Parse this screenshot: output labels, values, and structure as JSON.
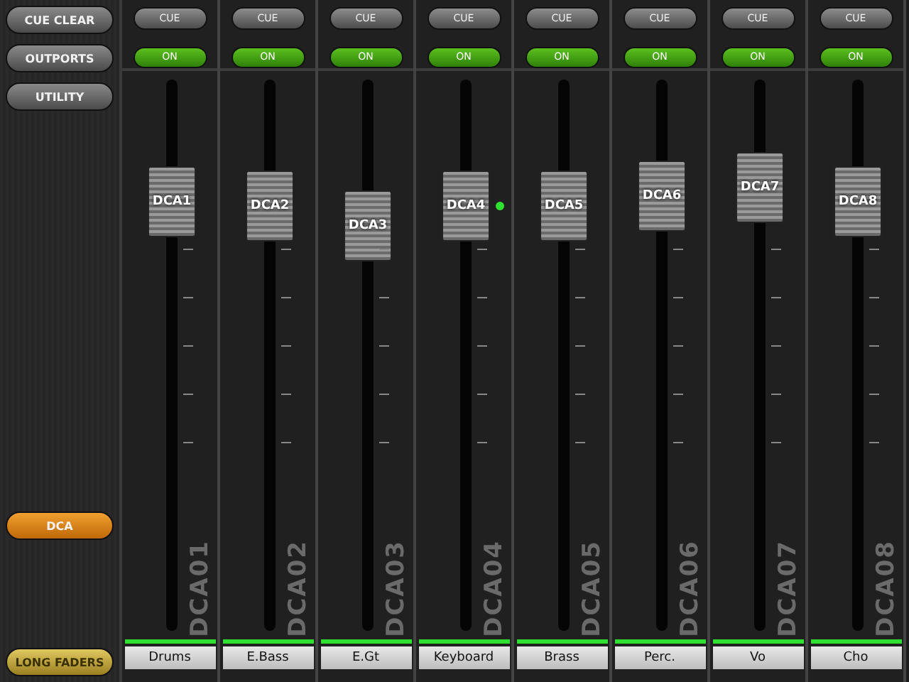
{
  "sidebar": {
    "buttons": [
      {
        "label": "CUE CLEAR",
        "kind": "top",
        "selected": false
      },
      {
        "label": "OUTPORTS",
        "kind": "top",
        "selected": false
      },
      {
        "label": "UTILITY",
        "kind": "top",
        "selected": false
      },
      {
        "label": "DCA",
        "kind": "middle",
        "selected": true
      },
      {
        "label": "LONG FADERS",
        "kind": "bottom",
        "selected": true
      }
    ]
  },
  "channels": [
    {
      "cue": "CUE",
      "cue_on": false,
      "on_label": "ON",
      "on": true,
      "fader_label": "DCA1",
      "level": 0.82,
      "signal": false,
      "id_label": "DCA01",
      "name": "Drums",
      "assigned": true
    },
    {
      "cue": "CUE",
      "cue_on": false,
      "on_label": "ON",
      "on": true,
      "fader_label": "DCA2",
      "level": 0.81,
      "signal": false,
      "id_label": "DCA02",
      "name": "E.Bass",
      "assigned": true
    },
    {
      "cue": "CUE",
      "cue_on": false,
      "on_label": "ON",
      "on": true,
      "fader_label": "DCA3",
      "level": 0.77,
      "signal": false,
      "id_label": "DCA03",
      "name": "E.Gt",
      "assigned": true
    },
    {
      "cue": "CUE",
      "cue_on": false,
      "on_label": "ON",
      "on": true,
      "fader_label": "DCA4",
      "level": 0.81,
      "signal": true,
      "id_label": "DCA04",
      "name": "Keyboard",
      "assigned": true
    },
    {
      "cue": "CUE",
      "cue_on": false,
      "on_label": "ON",
      "on": true,
      "fader_label": "DCA5",
      "level": 0.81,
      "signal": false,
      "id_label": "DCA05",
      "name": "Brass",
      "assigned": true
    },
    {
      "cue": "CUE",
      "cue_on": false,
      "on_label": "ON",
      "on": true,
      "fader_label": "DCA6",
      "level": 0.83,
      "signal": false,
      "id_label": "DCA06",
      "name": "Perc.",
      "assigned": true
    },
    {
      "cue": "CUE",
      "cue_on": false,
      "on_label": "ON",
      "on": true,
      "fader_label": "DCA7",
      "level": 0.85,
      "signal": false,
      "id_label": "DCA07",
      "name": "Vo",
      "assigned": true
    },
    {
      "cue": "CUE",
      "cue_on": false,
      "on_label": "ON",
      "on": true,
      "fader_label": "DCA8",
      "level": 0.82,
      "signal": false,
      "id_label": "DCA08",
      "name": "Cho",
      "assigned": true
    }
  ]
}
